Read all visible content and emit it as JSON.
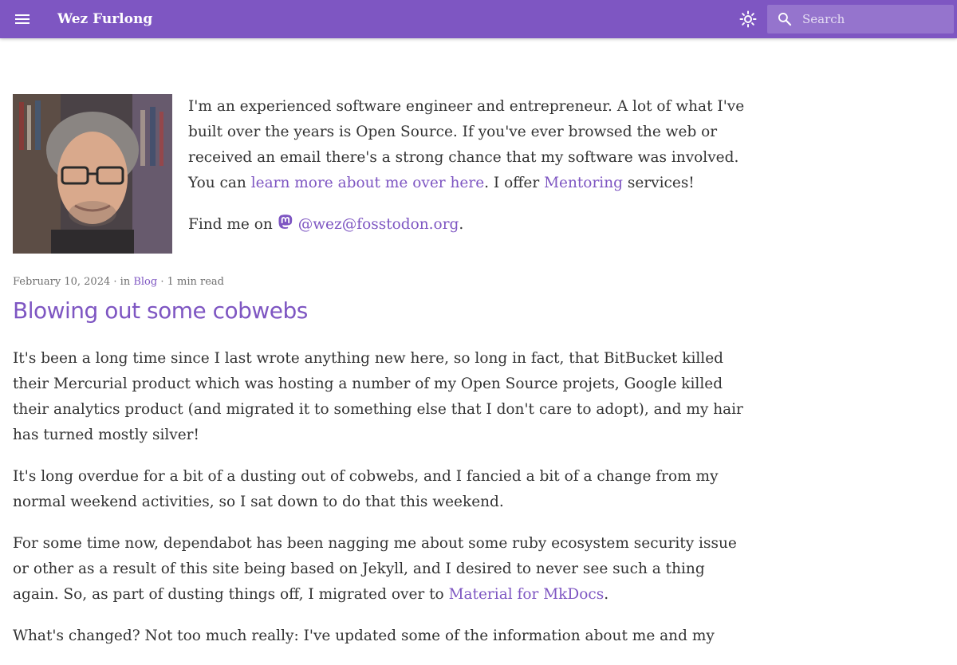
{
  "header": {
    "site_title": "Wez Furlong",
    "menu_icon": "menu-icon",
    "theme_icon": "brightness-icon",
    "search": {
      "placeholder": "Search",
      "icon": "search-icon"
    }
  },
  "colors": {
    "primary": "#7e56c2",
    "text": "#333333",
    "meta": "#6f6f6f"
  },
  "intro": {
    "p1_text": "I'm an experienced software engineer and entrepreneur. A lot of what I've built over the years is Open Source. If you've ever browsed the web or received an email there's a strong chance that my software was involved. You can ",
    "p1_link1": "learn more about me over here",
    "p1_mid": ". I offer ",
    "p1_link2": "Mentoring",
    "p1_end": " services!",
    "p2_text": "Find me on ",
    "p2_icon": "mastodon-icon",
    "p2_link": "@wez@fosstodon.org",
    "p2_end": "."
  },
  "post": {
    "date": "February 10, 2024",
    "in_label": "in",
    "category": "Blog",
    "read_time": "1 min read",
    "title": "Blowing out some cobwebs",
    "p1": "It's been a long time since I last wrote anything new here, so long in fact, that BitBucket killed their Mercurial product which was hosting a number of my Open Source projets, Google killed their analytics product (and migrated it to something else that I don't care to adopt), and my hair has turned mostly silver!",
    "p2": "It's long overdue for a bit of a dusting out of cobwebs, and I fancied a bit of a change from my normal weekend activities, so I sat down to do that this weekend.",
    "p3_text": "For some time now, dependabot has been nagging me about some ruby ecosystem security issue or other as a result of this site being based on Jekyll, and I desired to never see such a thing again. So, as part of dusting things off, I migrated over to ",
    "p3_link": "Material for MkDocs",
    "p3_end": ".",
    "p4": "What's changed? Not too much really: I've updated some of the information about me and my"
  }
}
